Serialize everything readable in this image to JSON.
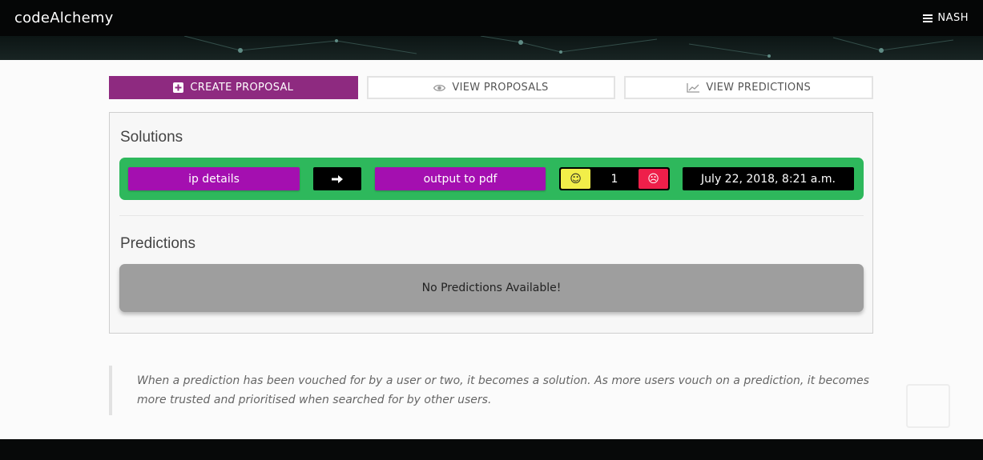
{
  "navbar": {
    "brand": "codeAlchemy",
    "user": "NASH",
    "menu_icon": "hamburger-icon"
  },
  "tabs": [
    {
      "label": "CREATE PROPOSAL",
      "icon": "plus-square-icon",
      "active": true
    },
    {
      "label": "VIEW PROPOSALS",
      "icon": "eye-icon",
      "active": false
    },
    {
      "label": "VIEW PREDICTIONS",
      "icon": "line-chart-icon",
      "active": false
    }
  ],
  "solutions": {
    "title": "Solutions",
    "items": [
      {
        "from": "ip details",
        "to": "output to pdf",
        "votes": "1",
        "date": "July 22, 2018, 8:21 a.m."
      }
    ]
  },
  "predictions": {
    "title": "Predictions",
    "empty_text": "No Predictions Available!"
  },
  "info": {
    "text": "When a prediction has been vouched for by a user or two, it becomes a solution. As more users vouch on a prediction, it becomes more trusted and prioritised when searched for by other users."
  },
  "colors": {
    "accent": "#8e2a80",
    "solution_row": "#2eb85c",
    "pill_purple": "#a40fb0",
    "upvote": "#f2ee49",
    "downvote": "#ee1f4a",
    "prediction_box": "#9e9e9e"
  }
}
